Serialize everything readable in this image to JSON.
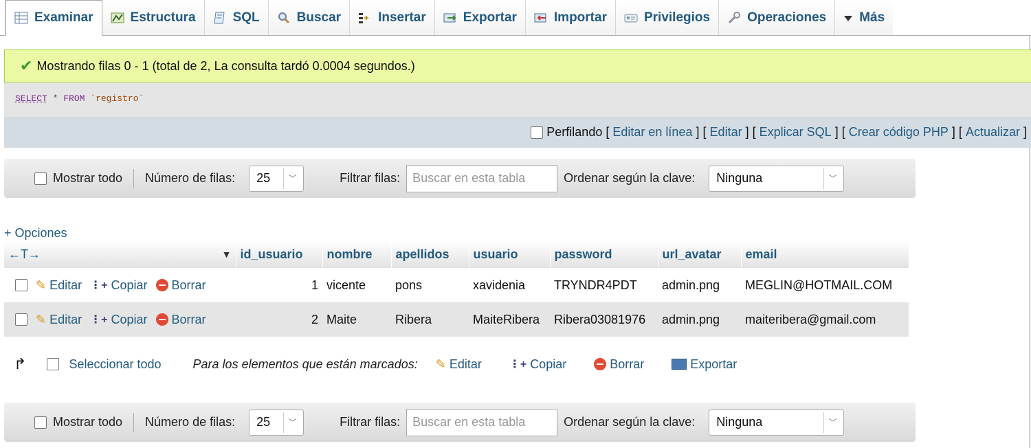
{
  "tabs": [
    {
      "label": "Examinar",
      "icon": "table-browse-icon",
      "active": true
    },
    {
      "label": "Estructura",
      "icon": "structure-icon"
    },
    {
      "label": "SQL",
      "icon": "sql-icon"
    },
    {
      "label": "Buscar",
      "icon": "search-icon"
    },
    {
      "label": "Insertar",
      "icon": "insert-icon"
    },
    {
      "label": "Exportar",
      "icon": "export-icon"
    },
    {
      "label": "Importar",
      "icon": "import-icon"
    },
    {
      "label": "Privilegios",
      "icon": "privileges-icon"
    },
    {
      "label": "Operaciones",
      "icon": "wrench-icon"
    },
    {
      "label": "Más",
      "icon": "triangle-down-icon"
    }
  ],
  "notice": {
    "text": "Mostrando filas 0 - 1 (total de 2, La consulta tardó 0.0004 segundos.)"
  },
  "sql": {
    "select": "SELECT",
    "star": "*",
    "from": "FROM",
    "table": "`registro`"
  },
  "sql_links": {
    "profiling": "Perfilando",
    "open_bracket": "[",
    "close_bracket": "]",
    "links": [
      "Editar en línea",
      "Editar",
      "Explicar SQL",
      "Crear código PHP",
      "Actualizar"
    ]
  },
  "nav": {
    "show_all": "Mostrar todo",
    "rows_label": "Número de filas:",
    "rows_value": "25",
    "filter_label": "Filtrar filas:",
    "filter_placeholder": "Buscar en esta tabla",
    "sort_label": "Ordenar según la clave:",
    "sort_value": "Ninguna"
  },
  "options_link": "+ Opciones",
  "table": {
    "arrows": "←T→",
    "columns": [
      "id_usuario",
      "nombre",
      "apellidos",
      "usuario",
      "password",
      "url_avatar",
      "email"
    ],
    "actions": {
      "edit": "Editar",
      "copy": "Copiar",
      "delete": "Borrar"
    },
    "rows": [
      {
        "id_usuario": "1",
        "nombre": "vicente",
        "apellidos": "pons",
        "usuario": "xavidenia",
        "password": "TRYNDR4PDT",
        "url_avatar": "admin.png",
        "email": "MEGLIN@HOTMAIL.COM"
      },
      {
        "id_usuario": "2",
        "nombre": "Maite",
        "apellidos": "Ribera",
        "usuario": "MaiteRibera",
        "password": "Ribera03081976",
        "url_avatar": "admin.png",
        "email": "maiteribera@gmail.com"
      }
    ]
  },
  "bulk": {
    "select_all": "Seleccionar todo",
    "marked_label": "Para los elementos que están marcados:",
    "edit": "Editar",
    "copy": "Copiar",
    "delete": "Borrar",
    "export": "Exportar"
  }
}
